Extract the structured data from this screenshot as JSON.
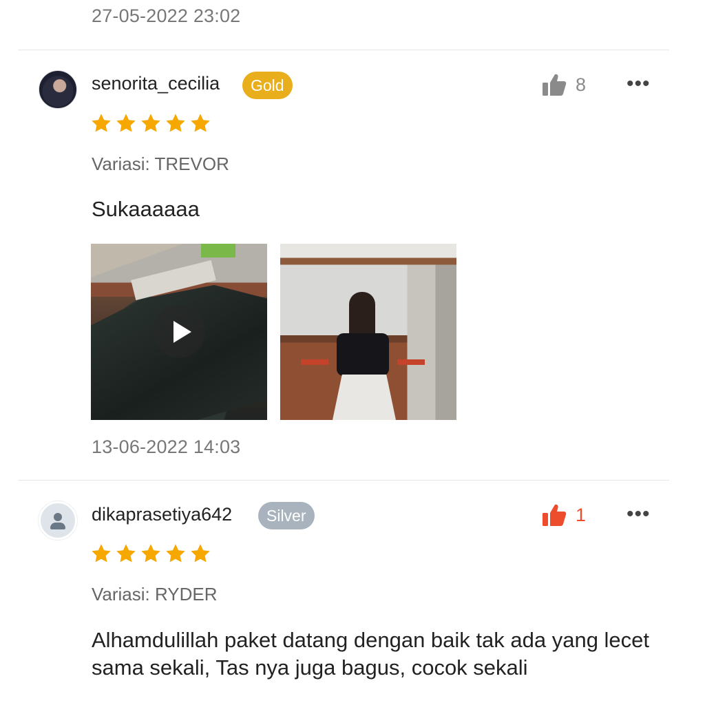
{
  "top_timestamp": "27-05-2022 23:02",
  "reviews": [
    {
      "username": "senorita_cecilia",
      "badge": "Gold",
      "badge_color": "#e8ae1b",
      "likes": "8",
      "liked": false,
      "like_icon": "thumbs-up-icon",
      "more_icon": "more-icon",
      "more_label": "•••",
      "rating": 5,
      "variant": "Variasi: TREVOR",
      "comment": "Sukaaaaaa",
      "media": [
        {
          "type": "video",
          "icon": "play-icon"
        },
        {
          "type": "photo"
        }
      ],
      "timestamp": "13-06-2022 14:03"
    },
    {
      "username": "dikaprasetiya642",
      "badge": "Silver",
      "badge_color": "#a9b3bd",
      "likes": "1",
      "liked": true,
      "like_color": "#ee4d2d",
      "like_icon": "thumbs-up-icon",
      "more_icon": "more-icon",
      "more_label": "•••",
      "rating": 5,
      "variant": "Variasi: RYDER",
      "comment": "Alhamdulillah paket datang dengan baik tak ada yang lecet sama sekali, Tas nya juga bagus, cocok sekali"
    }
  ],
  "colors": {
    "star": "#f6a700",
    "like_inactive": "#8a8a8a",
    "like_active": "#ee4d2d"
  }
}
